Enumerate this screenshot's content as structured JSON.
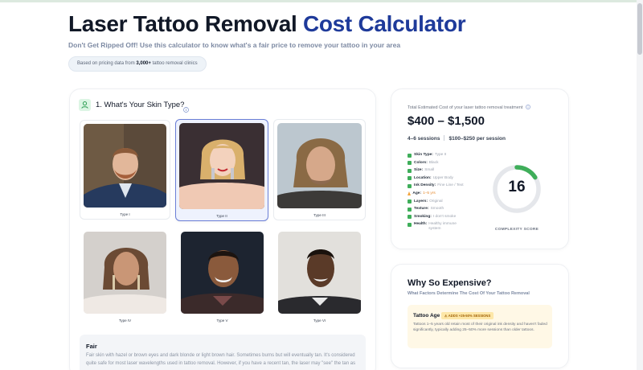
{
  "hero": {
    "title_main": "Laser Tattoo Removal ",
    "title_accent": "Cost Calculator",
    "subtitle": "Don't Get Ripped Off! Use this calculator to know what's a fair price to remove your tattoo in your area",
    "pill_prefix": "Based on pricing data from ",
    "pill_bold": "3,000+",
    "pill_suffix": " tattoo removal clinics"
  },
  "skin_section": {
    "title": "1. What's Your Skin Type?",
    "icon": "person-icon",
    "info_icon": "info-icon",
    "types": [
      {
        "label": "Type I",
        "selected": false
      },
      {
        "label": "Type II",
        "selected": true
      },
      {
        "label": "Type III",
        "selected": false
      },
      {
        "label": "Type IV",
        "selected": false
      },
      {
        "label": "Type V",
        "selected": false
      },
      {
        "label": "Type VI",
        "selected": false
      }
    ],
    "description_title": "Fair",
    "description_text": "Fair skin with hazel or brown eyes and dark blonde or light brown hair. Sometimes burns but will eventually tan. It's considered quite safe for most laser wavelengths used in tattoo removal. However, if you have a recent tan, the laser may \"see\" the tan as"
  },
  "cost": {
    "heading": "Total Estimated Cost of your laser tattoo removal treatment",
    "range": "$400 – $1,500",
    "sessions": "4–6 sessions",
    "per_session": "$100–$250 per session",
    "factors": [
      {
        "key": "Skin Type:",
        "value": "Type II",
        "status": "ok"
      },
      {
        "key": "Colors:",
        "value": "Black",
        "status": "ok"
      },
      {
        "key": "Size:",
        "value": "Small",
        "status": "ok"
      },
      {
        "key": "Location:",
        "value": "Upper Body",
        "status": "ok"
      },
      {
        "key": "Ink Density:",
        "value": "Fine Line / Text",
        "status": "ok"
      },
      {
        "key": "Age:",
        "value": "1–5 yrs",
        "status": "warn"
      },
      {
        "key": "Layers:",
        "value": "Original",
        "status": "ok"
      },
      {
        "key": "Texture:",
        "value": "Smooth",
        "status": "ok"
      },
      {
        "key": "Smoking:",
        "value": "I don't smoke",
        "status": "ok"
      },
      {
        "key": "Health:",
        "value": "Healthy immune system",
        "status": "ok"
      }
    ],
    "complexity_score": "16",
    "complexity_fraction": 0.16,
    "complexity_label": "COMPLEXITY SCORE",
    "colors": {
      "accent_green": "#3fae5a",
      "warn_orange": "#f2a33a",
      "track": "#e5e7eb"
    }
  },
  "why": {
    "title": "Why So Expensive?",
    "subtitle": "What Factors Determine The Cost Of Your Tattoo Removal",
    "age_heading": "Tattoo Age",
    "age_badge": "⚠ ADDS +25-50% SESSIONS",
    "age_text": "Tattoos 1–5 years old retain most of their original ink density and haven't faded significantly, typically adding 25–50% more sessions than older tattoos."
  }
}
